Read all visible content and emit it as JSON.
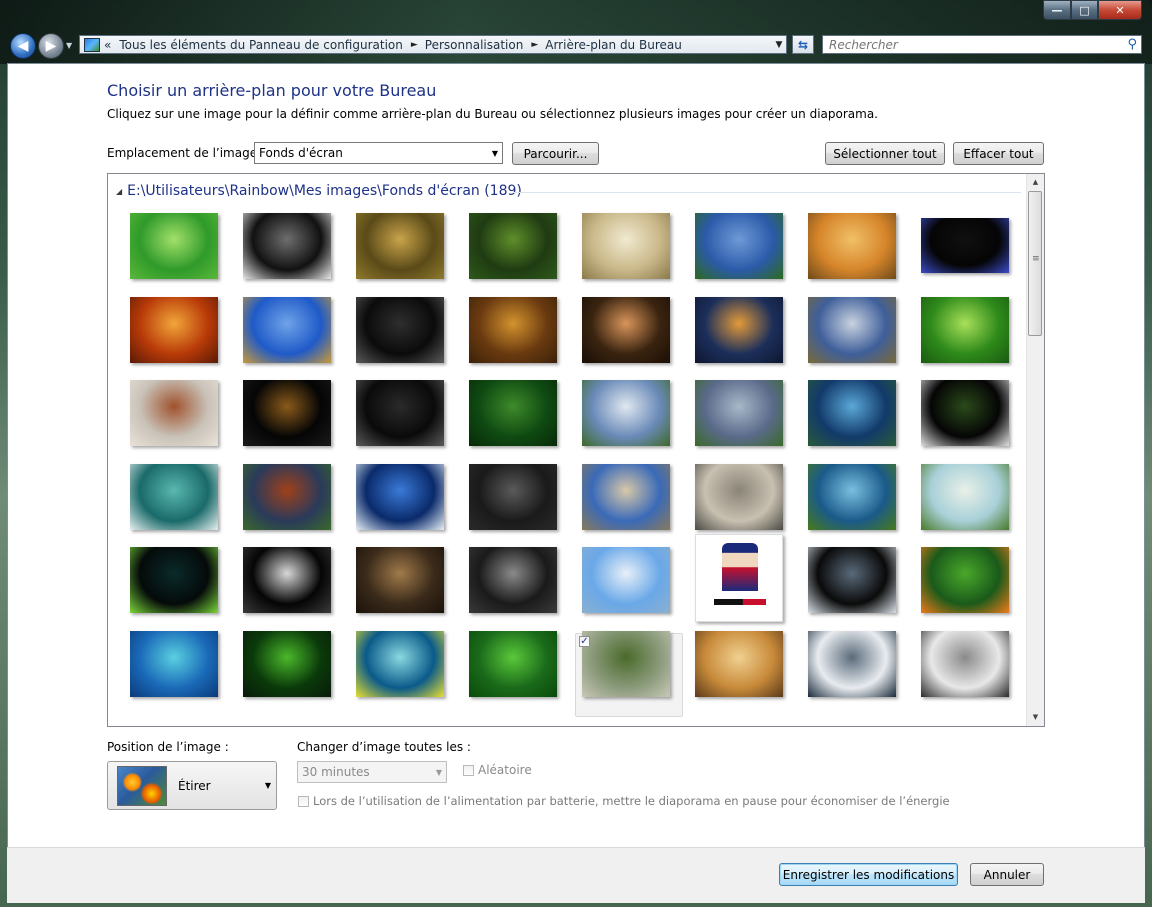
{
  "window": {
    "minimize_glyph": "—",
    "maximize_glyph": "□",
    "close_glyph": "✕"
  },
  "nav": {
    "back_glyph": "◀",
    "forward_glyph": "▶"
  },
  "address_bar": {
    "overflow": "«",
    "segments": [
      "Tous les éléments du Panneau de configuration",
      "Personnalisation",
      "Arrière-plan du Bureau"
    ],
    "separator": "►",
    "dropdown_glyph": "▼"
  },
  "search": {
    "placeholder": "Rechercher",
    "icon": "search-icon"
  },
  "page": {
    "title": "Choisir un arrière-plan pour votre Bureau",
    "description": "Cliquez sur une image pour la définir comme arrière-plan du Bureau ou sélectionnez plusieurs images pour créer un diaporama."
  },
  "location": {
    "label": "Emplacement de l’image :",
    "value": "Fonds d'écran",
    "browse_label": "Parcourir...",
    "select_all_label": "Sélectionner tout",
    "clear_all_label": "Effacer tout"
  },
  "gallery": {
    "folder_header": "E:\\Utilisateurs\\Rainbow\\Mes images\\Fonds d'écran (189)",
    "selected_index": 36,
    "thumbnails": [
      {
        "name": "green-emblem",
        "colors": [
          "#2f9a2a",
          "#a3e06a",
          "#5bb83a"
        ]
      },
      {
        "name": "light-figure",
        "colors": [
          "#111111",
          "#6e6e6e",
          "#e8e8e8"
        ]
      },
      {
        "name": "autumn-forest-path",
        "colors": [
          "#5a4a18",
          "#c9a44a",
          "#8f7a2c"
        ]
      },
      {
        "name": "forest-stream",
        "colors": [
          "#1f3b12",
          "#5f8f2a",
          "#2f5a1a"
        ]
      },
      {
        "name": "birch-forest",
        "colors": [
          "#c9b889",
          "#f1ead0",
          "#8a7a4a"
        ]
      },
      {
        "name": "barn-field",
        "colors": [
          "#2b5aa8",
          "#6f9ad8",
          "#2c6a1e"
        ]
      },
      {
        "name": "wheat-sunset",
        "colors": [
          "#d6852a",
          "#f1c068",
          "#6e4a1a"
        ]
      },
      {
        "name": "blue-flower-dark",
        "colors": [
          "#050505",
          "#101010",
          "#3a4cc8"
        ]
      },
      {
        "name": "fiery-cliff",
        "colors": [
          "#b83a08",
          "#f2a63a",
          "#5a1a06"
        ]
      },
      {
        "name": "field-blue-sky",
        "colors": [
          "#1f5ac8",
          "#6fa3e8",
          "#c99a38"
        ]
      },
      {
        "name": "dark-speakers",
        "colors": [
          "#0b0b0b",
          "#2e2e2e",
          "#5a5a5a"
        ]
      },
      {
        "name": "autumn-trees",
        "colors": [
          "#6a3a10",
          "#d3932e",
          "#3a2208"
        ]
      },
      {
        "name": "silhouette-plants",
        "colors": [
          "#3a2410",
          "#d9955a",
          "#1a0e05"
        ]
      },
      {
        "name": "lake-sunset",
        "colors": [
          "#1c2f5a",
          "#e39a3a",
          "#0e1630"
        ]
      },
      {
        "name": "cloudy-road",
        "colors": [
          "#3f5f9a",
          "#c9d3e0",
          "#7a6a3a"
        ]
      },
      {
        "name": "green-leaf",
        "colors": [
          "#2e8a1a",
          "#a8e05a",
          "#1a5a10"
        ]
      },
      {
        "name": "misty-autumn-road",
        "colors": [
          "#c8c2b8",
          "#a0522d",
          "#e8e2d8"
        ]
      },
      {
        "name": "jungle-giraffe",
        "colors": [
          "#050505",
          "#8a5a1a",
          "#1a1a1a"
        ]
      },
      {
        "name": "audio-jungle",
        "colors": [
          "#0a0a0a",
          "#2a2a2a",
          "#5a5a5a"
        ]
      },
      {
        "name": "jungle-canopy",
        "colors": [
          "#0f4a12",
          "#3e8a2a",
          "#082a08"
        ]
      },
      {
        "name": "mountain-valley",
        "colors": [
          "#6a8ab8",
          "#e0e8f0",
          "#3e6a2a"
        ]
      },
      {
        "name": "yosemite-valley",
        "colors": [
          "#5a6a8a",
          "#a8b8c8",
          "#3a6a2a"
        ]
      },
      {
        "name": "tree-blue-lake",
        "colors": [
          "#123a6a",
          "#5aa8d8",
          "#2a5a3a"
        ]
      },
      {
        "name": "ball-field",
        "colors": [
          "#050505",
          "#2a4a1a",
          "#e0e0e0"
        ]
      },
      {
        "name": "boat-teal-water",
        "colors": [
          "#1a6a6a",
          "#5ab8b0",
          "#e8f0f0"
        ]
      },
      {
        "name": "red-soil-field",
        "colors": [
          "#2a3a5a",
          "#a0401a",
          "#3a6a2a"
        ]
      },
      {
        "name": "mountain-lake-reflection",
        "colors": [
          "#0a2a6a",
          "#3a7ad8",
          "#e8f0f8"
        ]
      },
      {
        "name": "dark-city",
        "colors": [
          "#1a1a1a",
          "#5a5a5a",
          "#2a2a2a"
        ]
      },
      {
        "name": "desert-plain",
        "colors": [
          "#3a6ab8",
          "#d8c8a8",
          "#8a7a5a"
        ]
      },
      {
        "name": "hazy-city",
        "colors": [
          "#c8c0b0",
          "#8a8478",
          "#4a4a44"
        ]
      },
      {
        "name": "house-on-hill",
        "colors": [
          "#1a5a8a",
          "#7ac0e0",
          "#4a7a1a"
        ]
      },
      {
        "name": "old-house-grass",
        "colors": [
          "#a8d0d8",
          "#e8f0e8",
          "#4a7a2a"
        ]
      },
      {
        "name": "green-apple-logo",
        "colors": [
          "#050a0a",
          "#0a2a2a",
          "#7ad83a"
        ]
      },
      {
        "name": "sports-car",
        "colors": [
          "#050505",
          "#d8d8d8",
          "#3a3a3a"
        ]
      },
      {
        "name": "battle-scene",
        "colors": [
          "#3a2a1a",
          "#a07a4a",
          "#1a120a"
        ]
      },
      {
        "name": "soldier-helmet",
        "colors": [
          "#1a1a1a",
          "#8a8a8a",
          "#3a3a3a"
        ]
      },
      {
        "name": "snowy-mountains",
        "colors": [
          "#6aa8e8",
          "#e8f0f8",
          "#8ab0d0"
        ]
      },
      {
        "name": "uncle-sam",
        "colors": [
          "#ffffff",
          "#f4f4f4",
          "#c8102e"
        ]
      },
      {
        "name": "windows-frame-dark",
        "colors": [
          "#0a0a0a",
          "#5a6a7a",
          "#d8e0e8"
        ]
      },
      {
        "name": "clownfish-anemone",
        "colors": [
          "#1a5a1a",
          "#4aa82a",
          "#f07a1a"
        ]
      },
      {
        "name": "aqua-light-rays",
        "colors": [
          "#1a6ab8",
          "#5ad0e0",
          "#0a3a7a"
        ]
      },
      {
        "name": "leaf-water-drops",
        "colors": [
          "#0a3a0a",
          "#4ab82a",
          "#0a1a0a"
        ]
      },
      {
        "name": "vista-aurora",
        "colors": [
          "#0a5a8a",
          "#8ad8e0",
          "#e8e030"
        ]
      },
      {
        "name": "green-grass",
        "colors": [
          "#1a6a1a",
          "#5ac83a",
          "#0a4a0a"
        ]
      },
      {
        "name": "abandoned-cottage",
        "colors": [
          "#8a9a7a",
          "#4a6a2a",
          "#c8c8b8"
        ]
      },
      {
        "name": "sunset-field",
        "colors": [
          "#c88a3a",
          "#f0d090",
          "#5a3a1a"
        ]
      },
      {
        "name": "windows-frame-light",
        "colors": [
          "#e8ecf0",
          "#5a6a7a",
          "#1a2a3a"
        ]
      },
      {
        "name": "white-wolf",
        "colors": [
          "#e8e8e8",
          "#8a8a8a",
          "#2a2a2a"
        ]
      }
    ]
  },
  "position": {
    "label": "Position de l’image :",
    "value": "Étirer"
  },
  "interval": {
    "label": "Changer d’image toutes les :",
    "value": "30 minutes",
    "shuffle_label": "Aléatoire",
    "battery_label": "Lors de l’utilisation de l’alimentation par batterie, mettre le diaporama en pause pour économiser de l’énergie"
  },
  "footer": {
    "save_label": "Enregistrer les modifications",
    "cancel_label": "Annuler"
  }
}
